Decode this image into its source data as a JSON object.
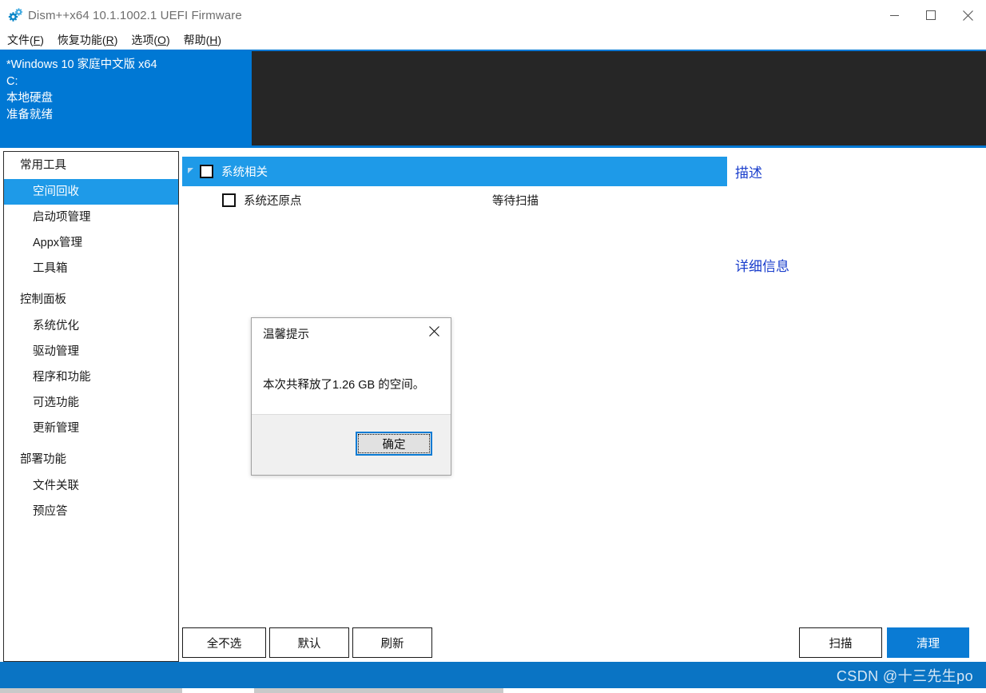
{
  "window": {
    "title": "Dism++x64 10.1.1002.1 UEFI Firmware",
    "icon": "gears-icon",
    "controls": {
      "minimize": "minimize-icon",
      "maximize": "maximize-icon",
      "close": "close-icon"
    }
  },
  "menubar": {
    "items": [
      {
        "label": "文件",
        "accel": "F"
      },
      {
        "label": "恢复功能",
        "accel": "R"
      },
      {
        "label": "选项",
        "accel": "O"
      },
      {
        "label": "帮助",
        "accel": "H"
      }
    ]
  },
  "sysinfo": {
    "lines": [
      "*Windows 10 家庭中文版 x64",
      "C:",
      "本地硬盘",
      "准备就绪"
    ]
  },
  "sidebar": {
    "groups": [
      {
        "header": "常用工具",
        "items": [
          {
            "label": "空间回收",
            "selected": true
          },
          {
            "label": "启动项管理",
            "selected": false
          },
          {
            "label": "Appx管理",
            "selected": false
          },
          {
            "label": "工具箱",
            "selected": false
          }
        ]
      },
      {
        "header": "控制面板",
        "items": [
          {
            "label": "系统优化",
            "selected": false
          },
          {
            "label": "驱动管理",
            "selected": false
          },
          {
            "label": "程序和功能",
            "selected": false
          },
          {
            "label": "可选功能",
            "selected": false
          },
          {
            "label": "更新管理",
            "selected": false
          }
        ]
      },
      {
        "header": "部署功能",
        "items": [
          {
            "label": "文件关联",
            "selected": false
          },
          {
            "label": "预应答",
            "selected": false
          }
        ]
      }
    ]
  },
  "content": {
    "tree": {
      "group": {
        "label": "系统相关",
        "expanded": true,
        "checked": false,
        "expander_icon": "triangle-expanded-icon"
      },
      "child": {
        "label": "系统还原点",
        "checked": false,
        "status": "等待扫描"
      }
    },
    "description_pane": {
      "title": "描述",
      "detail": "详细信息"
    }
  },
  "buttons": {
    "left": [
      {
        "label": "全不选",
        "name": "deselect-all-button"
      },
      {
        "label": "默认",
        "name": "default-button"
      },
      {
        "label": "刷新",
        "name": "refresh-button"
      }
    ],
    "right": [
      {
        "label": "扫描",
        "name": "scan-button",
        "primary": false
      },
      {
        "label": "清理",
        "name": "clean-button",
        "primary": true
      }
    ]
  },
  "dialog": {
    "visible": true,
    "title": "温馨提示",
    "message": "本次共释放了1.26 GB 的空间。",
    "ok_label": "确定",
    "close_icon": "close-icon"
  },
  "statusbar": {
    "watermark": "CSDN @十三先生po"
  },
  "colors": {
    "accent_blue": "#0078d4",
    "selection_blue": "#1e9ae8",
    "primary_button": "#0a7bd4",
    "status_bar": "#0a74c4",
    "dark_panel": "#262626",
    "description_text": "#1a3ecc"
  }
}
